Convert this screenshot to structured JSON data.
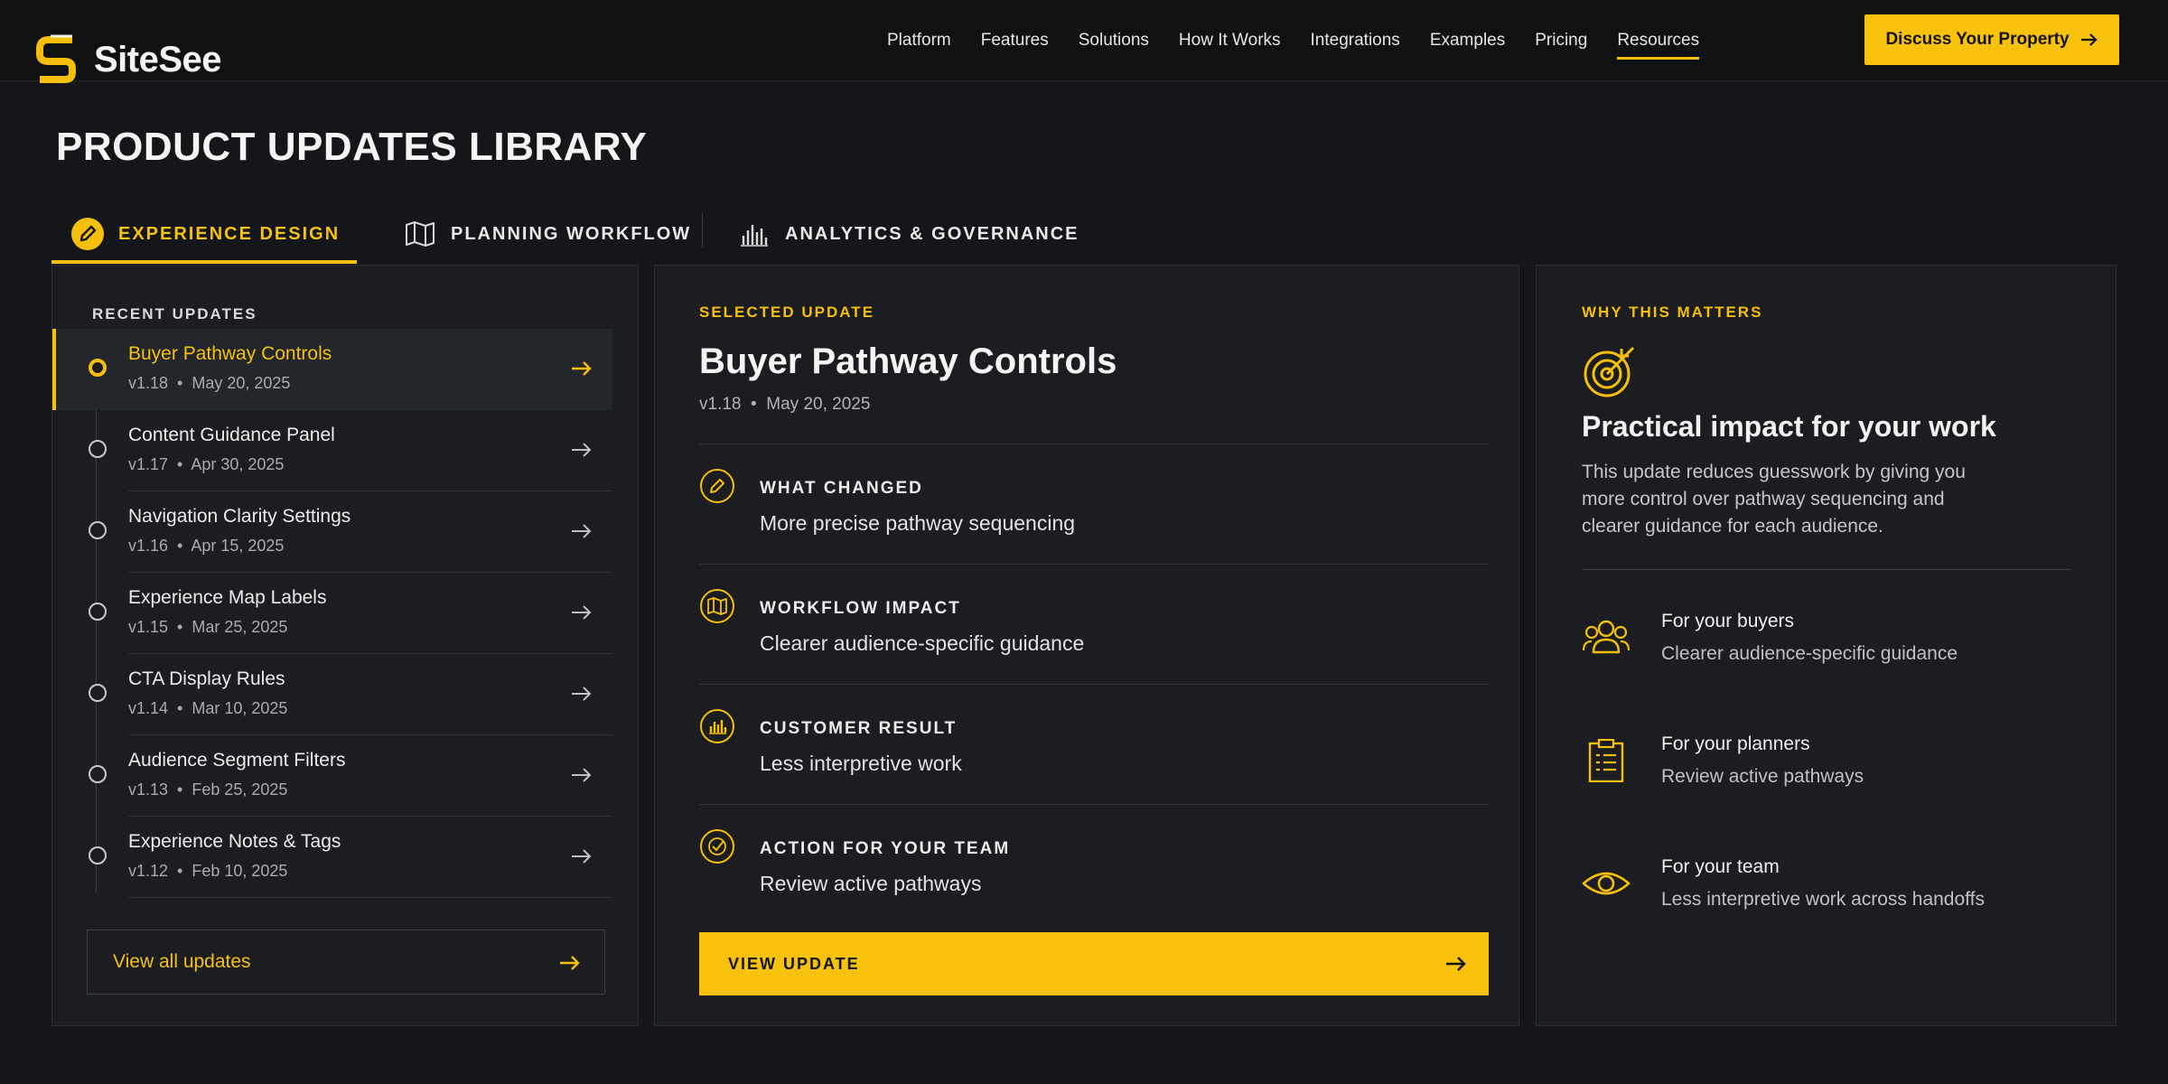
{
  "brand": {
    "name": "SiteSee",
    "accent": "#F5BF0B"
  },
  "nav": {
    "items": [
      "Platform",
      "Features",
      "Solutions",
      "How It Works",
      "Integrations",
      "Examples",
      "Pricing",
      "Resources"
    ],
    "active": "Resources",
    "cta": "Discuss Your Property"
  },
  "page": {
    "title": "PRODUCT UPDATES LIBRARY"
  },
  "tabs": [
    {
      "label": "EXPERIENCE DESIGN",
      "icon": "pencil-icon",
      "active": true
    },
    {
      "label": "PLANNING WORKFLOW",
      "icon": "map-icon",
      "active": false
    },
    {
      "label": "ANALYTICS & GOVERNANCE",
      "icon": "analytics-icon",
      "active": false
    }
  ],
  "recent": {
    "title": "RECENT UPDATES",
    "items": [
      {
        "name": "Buyer Pathway Controls",
        "version": "v1.18",
        "date": "May 20, 2025",
        "active": true
      },
      {
        "name": "Content Guidance Panel",
        "version": "v1.17",
        "date": "Apr 30, 2025"
      },
      {
        "name": "Navigation Clarity Settings",
        "version": "v1.16",
        "date": "Apr 15, 2025"
      },
      {
        "name": "Experience Map Labels",
        "version": "v1.15",
        "date": "Mar 25, 2025"
      },
      {
        "name": "CTA Display Rules",
        "version": "v1.14",
        "date": "Mar 10, 2025"
      },
      {
        "name": "Audience Segment Filters",
        "version": "v1.13",
        "date": "Feb 25, 2025"
      },
      {
        "name": "Experience Notes & Tags",
        "version": "v1.12",
        "date": "Feb 10, 2025"
      }
    ],
    "view_all": "View all updates"
  },
  "selected": {
    "eyebrow": "SELECTED UPDATE",
    "title": "Buyer Pathway Controls",
    "version": "v1.18",
    "date": "May 20, 2025",
    "sections": [
      {
        "head": "WHAT CHANGED",
        "body": "More precise pathway sequencing",
        "icon": "pencil-icon"
      },
      {
        "head": "WORKFLOW IMPACT",
        "body": "Clearer audience-specific guidance",
        "icon": "map-icon"
      },
      {
        "head": "CUSTOMER RESULT",
        "body": "Less interpretive work",
        "icon": "chart-icon"
      },
      {
        "head": "ACTION FOR YOUR TEAM",
        "body": "Review active pathways",
        "icon": "check-circle-icon"
      }
    ],
    "button": "VIEW UPDATE"
  },
  "why": {
    "eyebrow": "WHY THIS MATTERS",
    "title": "Practical impact for your work",
    "description": "This update reduces guesswork by giving you more control over pathway sequencing and clearer guidance for each audience.",
    "audiences": [
      {
        "head": "For your buyers",
        "body": "Clearer audience-specific guidance",
        "icon": "people-icon"
      },
      {
        "head": "For your planners",
        "body": "Review active pathways",
        "icon": "clipboard-icon"
      },
      {
        "head": "For your team",
        "body": "Less interpretive work across handoffs",
        "icon": "eye-icon"
      }
    ]
  }
}
